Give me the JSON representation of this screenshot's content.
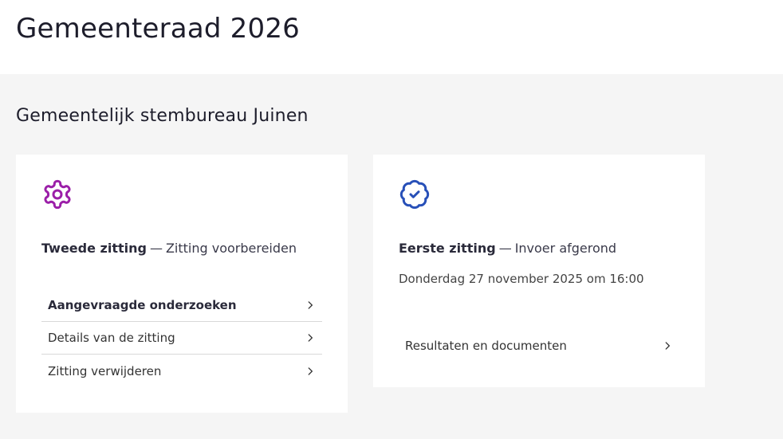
{
  "header": {
    "title": "Gemeenteraad 2026"
  },
  "main": {
    "section_title": "Gemeentelijk stembureau Juinen",
    "cards": [
      {
        "icon": "gear-icon",
        "heading_strong": "Tweede zitting",
        "heading_sep": "—",
        "heading_rest": "Zitting voorbereiden",
        "links": [
          "Aangevraagde onderzoeken",
          "Details van de zitting",
          "Zitting verwijderen"
        ]
      },
      {
        "icon": "badge-check-icon",
        "heading_strong": "Eerste zitting",
        "heading_sep": "—",
        "heading_rest": "Invoer afgerond",
        "subtitle": "Donderdag 27 november 2025 om 16:00",
        "links": [
          "Resultaten en documenten"
        ]
      }
    ]
  },
  "colors": {
    "gear_icon": "#9b1fa8",
    "badge_icon": "#2850b8",
    "background": "#f5f5f5"
  }
}
